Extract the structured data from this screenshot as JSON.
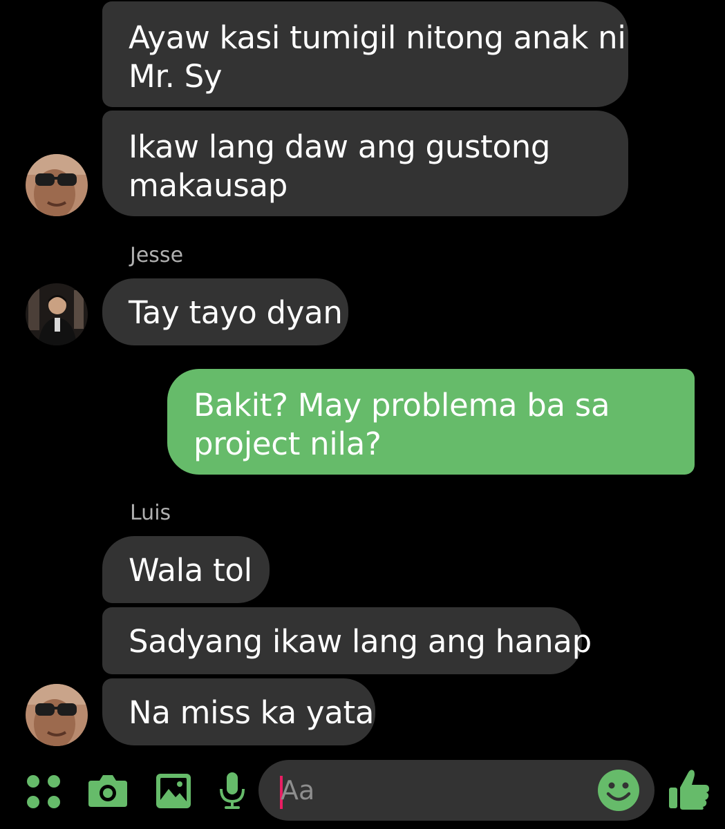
{
  "accent_color": "#66bb6a",
  "incoming_bubble_color": "#333333",
  "messages": [
    {
      "sender": "",
      "direction": "incoming",
      "lines": [
        "Ayaw kasi tumigil nitong anak ni",
        "Mr. Sy"
      ]
    },
    {
      "sender": "",
      "direction": "incoming",
      "lines": [
        "Ikaw lang daw ang gustong",
        "makausap"
      ],
      "avatar": "avatar-sunglasses-man"
    },
    {
      "sender": "Jesse",
      "direction": "incoming",
      "lines": [
        "Tay tayo dyan"
      ],
      "avatar": "avatar-man-in-suit"
    },
    {
      "sender": "",
      "direction": "outgoing",
      "lines": [
        "Bakit? May problema ba sa",
        "project nila?"
      ]
    },
    {
      "sender": "Luis",
      "direction": "incoming",
      "lines": [
        "Wala tol"
      ]
    },
    {
      "sender": "",
      "direction": "incoming",
      "lines": [
        "Sadyang ikaw lang ang hanap"
      ]
    },
    {
      "sender": "",
      "direction": "incoming",
      "lines": [
        "Na miss ka yata"
      ],
      "avatar": "avatar-sunglasses-man"
    }
  ],
  "composer": {
    "placeholder": "Aa",
    "icons": [
      "menu-dots-icon",
      "camera-icon",
      "gallery-icon",
      "microphone-icon",
      "emoji-icon",
      "thumbs-up-icon"
    ]
  }
}
